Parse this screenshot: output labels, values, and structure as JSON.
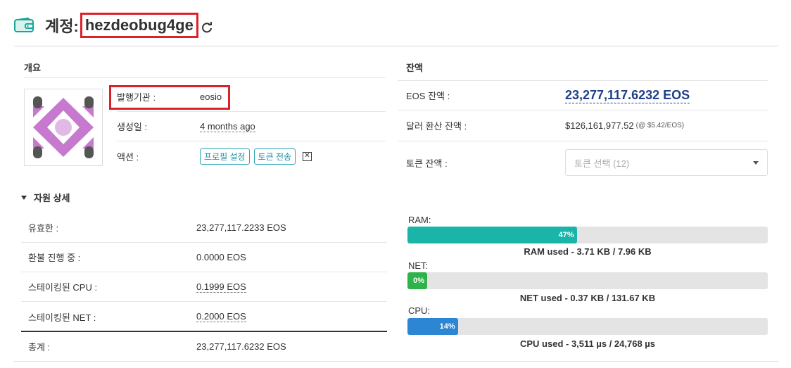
{
  "header": {
    "title_prefix": "계정:",
    "account_name": "hezdeobug4ge"
  },
  "overview": {
    "title": "개요",
    "issuer_label": "발행기관 :",
    "issuer_value": "eosio",
    "created_label": "생성일 :",
    "created_value": "4 months ago",
    "actions_label": "액션 :",
    "btn_profile": "프로필 설정",
    "btn_token_transfer": "토큰 전송",
    "close_glyph": "✕"
  },
  "resources": {
    "title": "자원 상세",
    "rows": [
      {
        "label": "유효한 :",
        "value": "23,277,117.2233 EOS"
      },
      {
        "label": "환불 진행 중 :",
        "value": "0.0000 EOS"
      },
      {
        "label": "스테이킹된 CPU :",
        "value": "0.1999 EOS"
      },
      {
        "label": "스테이킹된 NET :",
        "value": "0.2000 EOS"
      },
      {
        "label": "총계 :",
        "value": "23,277,117.6232 EOS"
      }
    ]
  },
  "balance": {
    "title": "잔액",
    "eos_label": "EOS 잔액 :",
    "eos_value": "23,277,117.6232 EOS",
    "usd_label": "달러 환산 잔액 :",
    "usd_value": "$126,161,977.52",
    "usd_rate": "(@ $5.42/EOS)",
    "token_label": "토큰 잔액 :",
    "token_select": "토큰 선택 (12)"
  },
  "usage": {
    "ram": {
      "label": "RAM:",
      "percent": 47,
      "percent_text": "47%",
      "caption": "RAM used - 3.71 KB / 7.96 KB",
      "color": "#1ab5a8"
    },
    "net": {
      "label": "NET:",
      "percent": 0,
      "percent_text": "0%",
      "caption": "NET used - 0.37 KB / 131.67 KB",
      "color": "#2db34a"
    },
    "cpu": {
      "label": "CPU:",
      "percent": 14,
      "percent_text": "14%",
      "caption": "CPU used - 3,511 µs / 24,768 µs",
      "color": "#2c86d3"
    }
  }
}
